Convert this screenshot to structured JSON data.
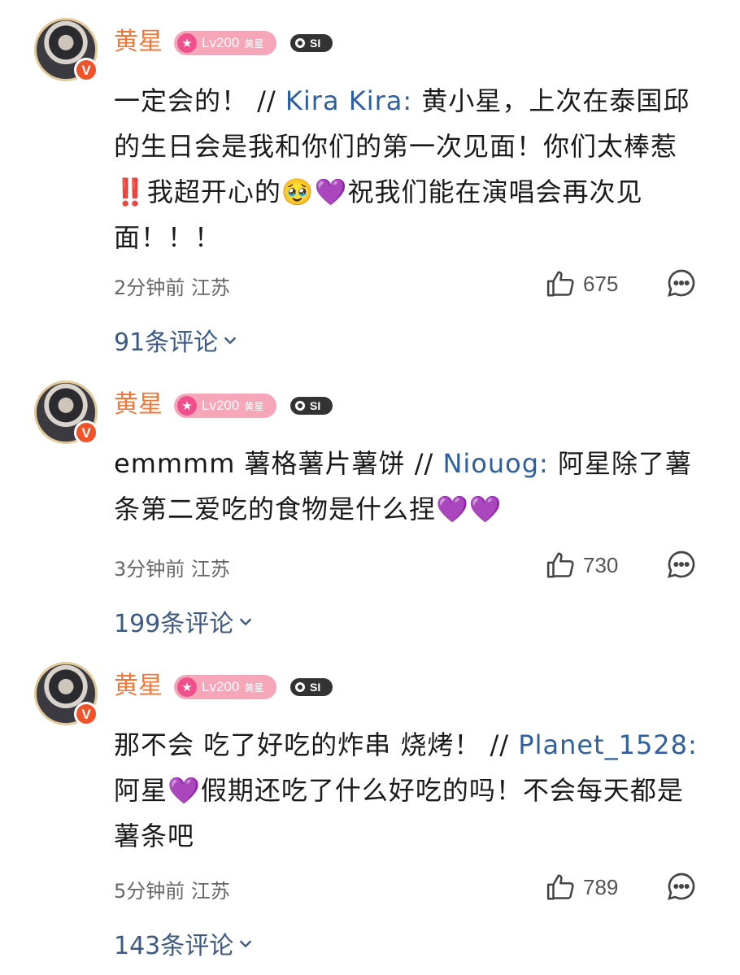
{
  "comments": [
    {
      "user": {
        "name": "黄星",
        "level": "Lv200",
        "level_name": "黄星",
        "verified_badge": "V",
        "tag": "SI"
      },
      "text_parts": [
        "一定会的！ // ",
        "Kira Kira:",
        " 黄小星，上次在泰国邱的生日会是我和你们的第一次见面！你们太棒惹",
        "‼️",
        "我超开心的",
        "🥹",
        "💜",
        "祝我们能在演唱会再次见面！！！"
      ],
      "time": "2分钟前",
      "location": "江苏",
      "likes": "675",
      "replies_label": "91条评论"
    },
    {
      "user": {
        "name": "黄星",
        "level": "Lv200",
        "level_name": "黄星",
        "verified_badge": "V",
        "tag": "SI"
      },
      "text_parts": [
        "emmmm 薯格薯片薯饼 // ",
        "Niouog:",
        " 阿星除了薯条第二爱吃的食物是什么捏",
        "💜💜"
      ],
      "time": "3分钟前",
      "location": "江苏",
      "likes": "730",
      "replies_label": "199条评论"
    },
    {
      "user": {
        "name": "黄星",
        "level": "Lv200",
        "level_name": "黄星",
        "verified_badge": "V",
        "tag": "SI"
      },
      "text_parts": [
        "那不会 吃了好吃的炸串 烧烤！ // ",
        "Planet_1528:",
        " 阿星",
        "💜",
        "假期还吃了什么好吃的吗！不会每天都是薯条吧"
      ],
      "time": "5分钟前",
      "location": "江苏",
      "likes": "789",
      "replies_label": "143条评论"
    }
  ],
  "colors": {
    "username": "#f0773a",
    "mention": "#2e5f9e",
    "replies": "#3c5a85",
    "meta": "#666666"
  },
  "icons": {
    "like": "thumbs-up-icon",
    "reply": "chat-bubble-icon",
    "expand": "chevron-down-icon"
  }
}
